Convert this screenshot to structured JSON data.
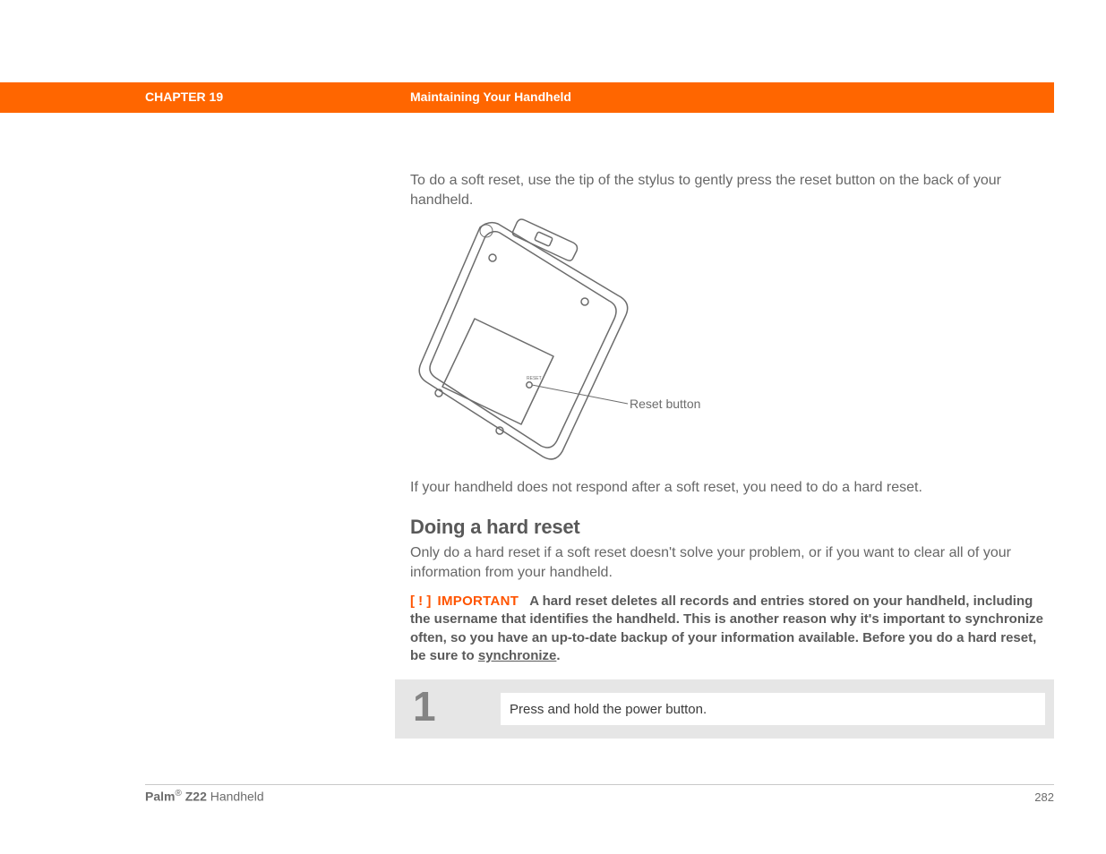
{
  "header": {
    "chapter": "CHAPTER 19",
    "title": "Maintaining Your Handheld"
  },
  "body": {
    "soft_reset": "To do a soft reset, use the tip of the stylus to gently press the reset button on the back of your handheld.",
    "reset_label": "Reset button",
    "after_soft": "If your handheld does not respond after a soft reset, you need to do a hard reset.",
    "hard_heading": "Doing a hard reset",
    "hard_intro": "Only do a hard reset if a soft reset doesn't solve your problem, or if you want to clear all of your information from your handheld."
  },
  "important": {
    "bracket": "[ ! ]",
    "tag": "IMPORTANT",
    "text_before": "A hard reset deletes all records and entries stored on your handheld, including the username that identifies the handheld. This is another reason why it's important to synchronize often, so you have an up-to-date backup of your information available. Before you do a hard reset, be sure to ",
    "link": "synchronize",
    "after": "."
  },
  "steps": [
    {
      "num": "1",
      "text": "Press and hold the power button."
    }
  ],
  "footer": {
    "brand_strong": "Palm",
    "brand_reg": "®",
    "brand_model": " Z22",
    "brand_suffix": " Handheld",
    "page": "282"
  },
  "diagram_tiny_label": "RESET"
}
